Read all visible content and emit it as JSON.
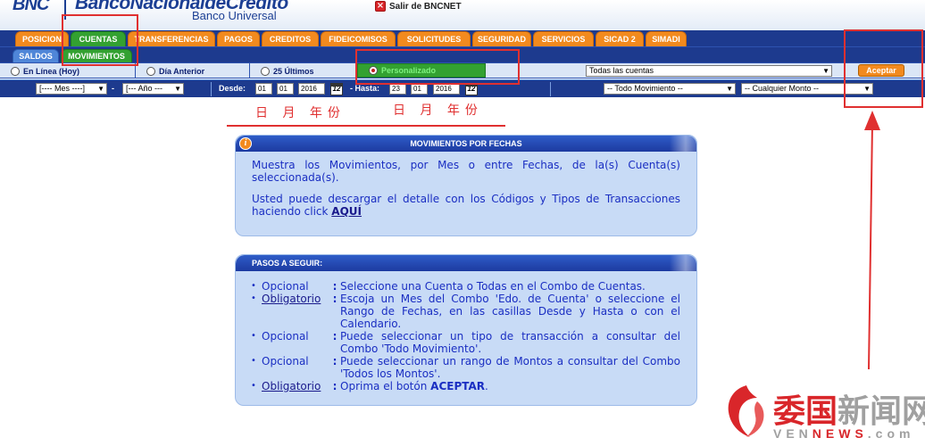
{
  "header": {
    "logo_abbr": "BNC",
    "bank_name": "BancoNacionaldeCrédito",
    "bank_subtitle": "Banco Universal",
    "exit_label": "Salir de BNCNET"
  },
  "main_tabs": [
    {
      "label": "POSICION"
    },
    {
      "label": "CUENTAS",
      "active": true
    },
    {
      "label": "TRANSFERENCIAS"
    },
    {
      "label": "PAGOS"
    },
    {
      "label": "CREDITOS"
    },
    {
      "label": "FIDEICOMISOS"
    },
    {
      "label": "SOLICITUDES"
    },
    {
      "label": "SEGURIDAD"
    },
    {
      "label": "SERVICIOS"
    },
    {
      "label": "SICAD 2"
    },
    {
      "label": "SIMADI"
    }
  ],
  "sub_tabs": [
    {
      "label": "SALDOS"
    },
    {
      "label": "MOVIMIENTOS",
      "active": true
    }
  ],
  "filters": {
    "radios": [
      {
        "label": "En Línea (Hoy)",
        "checked": false
      },
      {
        "label": "Día Anterior",
        "checked": false
      },
      {
        "label": "25 Últimos",
        "checked": false
      },
      {
        "label": "Personalizado",
        "checked": true
      }
    ],
    "account_select": "Todas las cuentas",
    "accept_label": "Aceptar",
    "month_select": "[---- Mes ----]",
    "year_select": "[--- Año ---",
    "dash": "-",
    "desde_label": "Desde:",
    "hasta_label": "- Hasta:",
    "desde": {
      "day": "01",
      "month": "01",
      "year": "2016"
    },
    "hasta": {
      "day": "23",
      "month": "01",
      "year": "2016"
    },
    "calendar_glyph": "12",
    "movement_select": "-- Todo Movimiento --",
    "amount_select": "-- Cualquier Monto --"
  },
  "annotations": {
    "date_labels_1": "日 月 年份",
    "date_labels_2": "日 月 年份"
  },
  "panel_info": {
    "title": "MOVIMIENTOS POR FECHAS",
    "icon_glyph": "i",
    "paragraph1": "Muestra los Movimientos, por Mes o entre Fechas, de la(s) Cuenta(s) seleccionada(s).",
    "paragraph2": "Usted puede descargar el detalle con los Códigos y Tipos de Transacciones haciendo click",
    "link_label": "AQUÍ"
  },
  "panel_steps": {
    "title": "PASOS A SEGUIR:",
    "bullet": "•",
    "colon": ":",
    "steps": [
      {
        "type": "Opcional",
        "link": false,
        "text": "Seleccione una Cuenta o Todas en el Combo de Cuentas."
      },
      {
        "type": "Obligatorio",
        "link": true,
        "text": "Escoja un Mes del Combo 'Edo. de Cuenta' o seleccione el Rango de Fechas, en las casillas Desde y Hasta o con el Calendario."
      },
      {
        "type": "Opcional",
        "link": false,
        "text": "Puede seleccionar un tipo de transacción a consultar del Combo 'Todo Movimiento'."
      },
      {
        "type": "Opcional",
        "link": false,
        "text": "Puede seleccionar un rango de Montos a consultar del Combo 'Todos los Montos'."
      },
      {
        "type": "Obligatorio",
        "link": true,
        "text": "Oprima el botón",
        "bold": "ACEPTAR",
        "tail": "."
      }
    ]
  },
  "watermark": {
    "cn_red": "委国",
    "cn_gray": "新闻网",
    "en_gray": "VEN",
    "en_red": "NEWS",
    "en_tail": ".com"
  }
}
